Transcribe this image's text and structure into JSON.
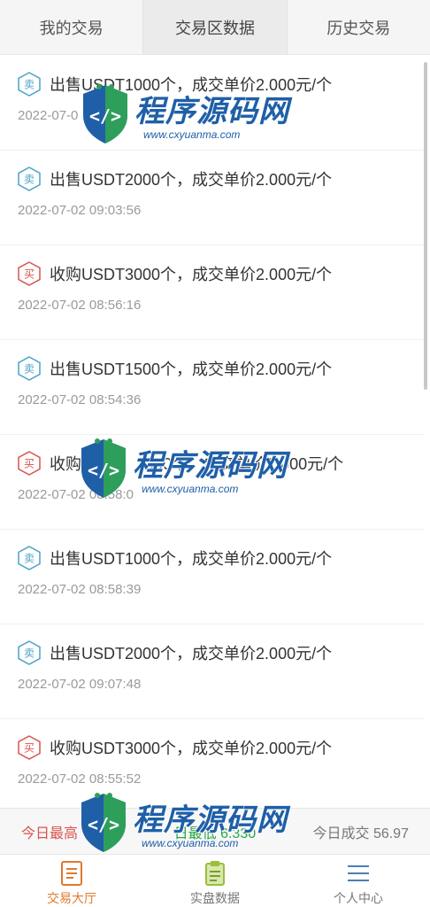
{
  "tabs": [
    {
      "label": "我的交易",
      "active": false
    },
    {
      "label": "交易区数据",
      "active": true
    },
    {
      "label": "历史交易",
      "active": false
    }
  ],
  "trades": [
    {
      "type": "sell",
      "badge": "卖",
      "description": "出售USDT1000个，成交单价2.000元/个",
      "time": "2022-07-0"
    },
    {
      "type": "sell",
      "badge": "卖",
      "description": "出售USDT2000个，成交单价2.000元/个",
      "time": "2022-07-02 09:03:56"
    },
    {
      "type": "buy",
      "badge": "买",
      "description": "收购USDT3000个，成交单价2.000元/个",
      "time": "2022-07-02 08:56:16"
    },
    {
      "type": "sell",
      "badge": "卖",
      "description": "出售USDT1500个，成交单价2.000元/个",
      "time": "2022-07-02 08:54:36"
    },
    {
      "type": "buy",
      "badge": "买",
      "description": "收购",
      "description_tail": "1300个，成交单价2.000元/个",
      "time": "2022-07-02 08:58:0"
    },
    {
      "type": "sell",
      "badge": "卖",
      "description": "出售USDT1000个，成交单价2.000元/个",
      "time": "2022-07-02 08:58:39"
    },
    {
      "type": "sell",
      "badge": "卖",
      "description": "出售USDT2000个，成交单价2.000元/个",
      "time": "2022-07-02 09:07:48"
    },
    {
      "type": "buy",
      "badge": "买",
      "description": "收购USDT3000个，成交单价2.000元/个",
      "time": "2022-07-02 08:55:52"
    }
  ],
  "stats": {
    "high_label": "今日最高",
    "high_value": "30",
    "low_label": "日最低",
    "low_value": "6.330",
    "volume_label": "今日成交",
    "volume_value": "56.97"
  },
  "bottom_nav": [
    {
      "label": "交易大厅",
      "icon": "document-list-icon",
      "active": true
    },
    {
      "label": "实盘数据",
      "icon": "clipboard-icon",
      "active": false
    },
    {
      "label": "个人中心",
      "icon": "menu-lines-icon",
      "active": false
    }
  ],
  "watermark": {
    "title": "程序源码网",
    "url": "www.cxyuanma.com"
  },
  "colors": {
    "sell": "#4aa3c9",
    "buy": "#d9534f",
    "active_nav": "#e07a2e",
    "stat_high": "#d9534f",
    "stat_low": "#28a745"
  }
}
